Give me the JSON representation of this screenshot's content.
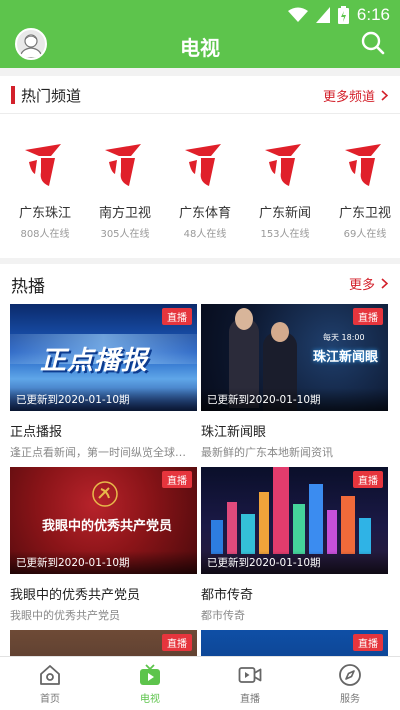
{
  "status_bar": {
    "time": "6:16"
  },
  "header": {
    "title": "电视"
  },
  "hot_channels": {
    "title": "热门频道",
    "more_label": "更多频道",
    "channels": [
      {
        "name": "广东珠江",
        "viewers": "808人在线"
      },
      {
        "name": "南方卫视",
        "viewers": "305人在线"
      },
      {
        "name": "广东体育",
        "viewers": "48人在线"
      },
      {
        "name": "广东新闻",
        "viewers": "153人在线"
      },
      {
        "name": "广东卫视",
        "viewers": "69人在线"
      }
    ]
  },
  "hot_broadcasts": {
    "title": "热播",
    "more_label": "更多",
    "items": [
      {
        "title": "正点播报",
        "subtitle": "逢正点看新闻，第一时间纵览全球…",
        "badge": "直播",
        "updated": "已更新到2020-01-10期",
        "thumb_text": "正点播报"
      },
      {
        "title": "珠江新闻眼",
        "subtitle": "最新鲜的广东本地新闻资讯",
        "badge": "直播",
        "updated": "已更新到2020-01-10期",
        "thumb_text": "珠江新闻眼",
        "thumb_caption": "每天 18:00"
      },
      {
        "title": "我眼中的优秀共产党员",
        "subtitle": "我眼中的优秀共产党员",
        "badge": "直播",
        "updated": "已更新到2020-01-10期",
        "thumb_text": "我眼中的优秀共产党员"
      },
      {
        "title": "都市传奇",
        "subtitle": "都市传奇",
        "badge": "直播",
        "updated": "已更新到2020-01-10期"
      },
      {
        "badge": "直播"
      },
      {
        "badge": "直播"
      }
    ]
  },
  "bottom_nav": {
    "items": [
      {
        "label": "首页",
        "icon": "home-icon"
      },
      {
        "label": "电视",
        "icon": "tv-icon",
        "active": true
      },
      {
        "label": "直播",
        "icon": "live-camera-icon"
      },
      {
        "label": "服务",
        "icon": "compass-icon"
      }
    ]
  },
  "colors": {
    "brand_green": "#5dc44c",
    "accent_red": "#d3212b",
    "live_badge": "#e6353d"
  }
}
